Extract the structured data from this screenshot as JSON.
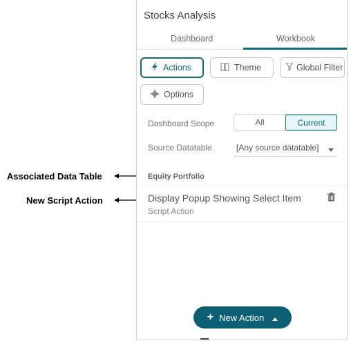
{
  "callouts": {
    "associated": "Associated Data Table",
    "new_script": "New Script Action"
  },
  "panel": {
    "title": "Stocks Analysis",
    "tabs": [
      {
        "label": "Dashboard"
      },
      {
        "label": "Workbook"
      }
    ],
    "active_tab": "Workbook",
    "buttons": {
      "actions": "Actions",
      "theme": "Theme",
      "global_filter": "Global Filter",
      "options": "Options"
    },
    "dashboard_scope": {
      "label": "Dashboard Scope",
      "options": [
        "All",
        "Current"
      ],
      "selected": "Current"
    },
    "source_datatable": {
      "label": "Source Datatable",
      "value": "[Any source datatable]"
    },
    "group_title": "Equity Portfolio",
    "action_item": {
      "title": "Display Popup Showing Select Item",
      "subtitle": "Script Action"
    },
    "new_action": "New Action"
  },
  "colors": {
    "accent": "#0e6b78",
    "new_button_bg": "#0d5f73"
  },
  "icons": {
    "actions": "lightning-icon",
    "theme": "book-icon",
    "global_filter": "filter-icon",
    "options": "gear-icon",
    "delete": "trash-icon",
    "dropdown": "chevron-down-icon",
    "new_plus": "plus-icon",
    "new_caret": "caret-up-icon"
  }
}
